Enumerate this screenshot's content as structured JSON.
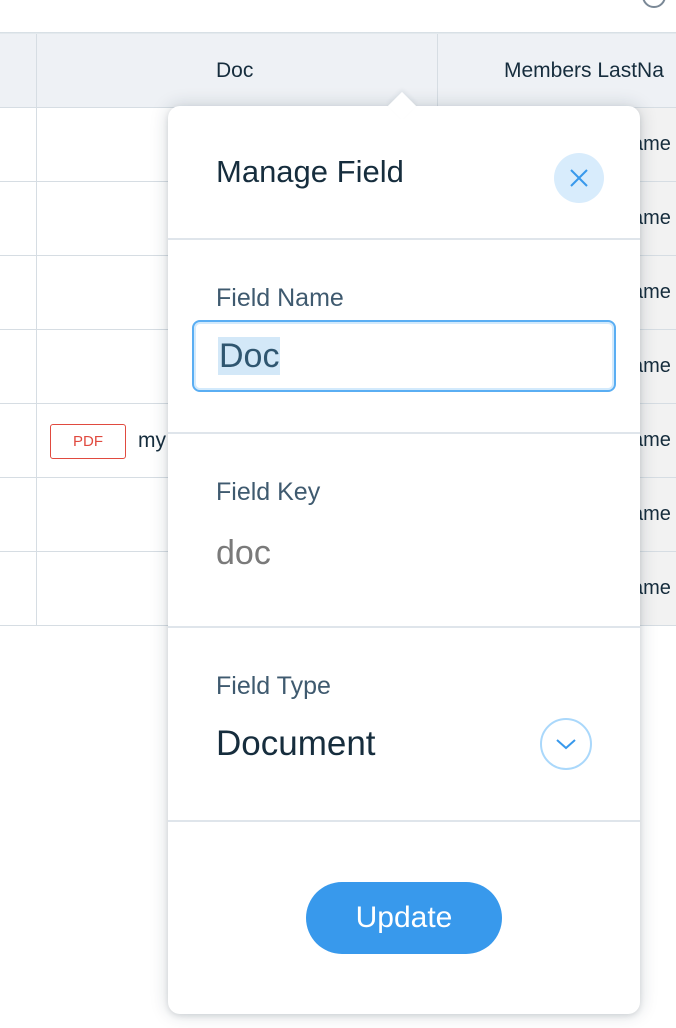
{
  "table": {
    "columns": [
      {
        "key": "doc",
        "label": "Doc"
      },
      {
        "key": "members_lastname",
        "label": "Members LastNa"
      }
    ],
    "rows": [
      {
        "lastname_fragment": "ame"
      },
      {
        "lastname_fragment": "ame"
      },
      {
        "lastname_fragment": "ame"
      },
      {
        "lastname_fragment": "ame"
      },
      {
        "doc_badge": "PDF",
        "doc_name_fragment": "my",
        "lastname_fragment": "ame"
      },
      {
        "lastname_fragment": "ame"
      },
      {
        "lastname_fragment": "ame"
      }
    ]
  },
  "manage_field": {
    "title": "Manage Field",
    "close_icon": "close-icon",
    "field_name_label": "Field Name",
    "field_name_value": "Doc",
    "field_key_label": "Field Key",
    "field_key_value": "doc",
    "field_type_label": "Field Type",
    "field_type_value": "Document",
    "dropdown_icon": "chevron-down-icon",
    "update_label": "Update"
  },
  "colors": {
    "accent": "#3899ec",
    "text": "#162d3d",
    "label": "#3f5a6f",
    "pdf_badge": "#e04a3f"
  }
}
